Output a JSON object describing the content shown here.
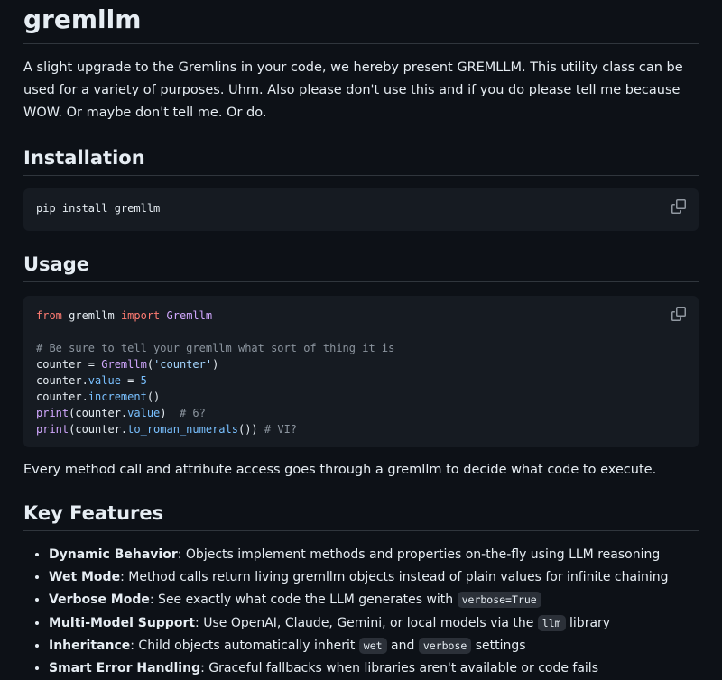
{
  "title": "gremllm",
  "intro": "A slight upgrade to the Gremlins in your code, we hereby present GREMLLM. This utility class can be used for a variety of purposes. Uhm. Also please don't use this and if you do please tell me because WOW. Or maybe don't tell me. Or do.",
  "installation": {
    "heading": "Installation",
    "command": "pip install gremllm"
  },
  "usage": {
    "heading": "Usage",
    "code": {
      "l1": {
        "kw1": "from",
        "mod": " gremllm ",
        "kw2": "import",
        "cls": " Gremllm"
      },
      "l3": "# Be sure to tell your gremllm what sort of thing it is",
      "l4": {
        "a": "counter = ",
        "cls": "Gremllm",
        "b": "(",
        "str": "'counter'",
        "c": ")"
      },
      "l5": {
        "a": "counter.",
        "attr": "value",
        "b": " = ",
        "num": "5"
      },
      "l6": {
        "a": "counter.",
        "fn": "increment",
        "b": "()"
      },
      "l7": {
        "fn": "print",
        "a": "(counter.",
        "attr": "value",
        "b": ")  ",
        "cm": "# 6?"
      },
      "l8": {
        "fn": "print",
        "a": "(counter.",
        "fn2": "to_roman_numerals",
        "b": "()) ",
        "cm": "# VI?"
      }
    },
    "description": "Every method call and attribute access goes through a gremllm to decide what code to execute."
  },
  "features": {
    "heading": "Key Features",
    "items": [
      {
        "name": "Dynamic Behavior",
        "text": ": Objects implement methods and properties on-the-fly using LLM reasoning"
      },
      {
        "name": "Wet Mode",
        "text": ": Method calls return living gremllm objects instead of plain values for infinite chaining"
      },
      {
        "name": "Verbose Mode",
        "text": ": See exactly what code the LLM generates with ",
        "code": "verbose=True"
      },
      {
        "name": "Multi-Model Support",
        "text": ": Use OpenAI, Claude, Gemini, or local models via the ",
        "code": "llm",
        "after": " library"
      },
      {
        "name": "Inheritance",
        "text": ": Child objects automatically inherit ",
        "code": "wet",
        "mid": " and ",
        "code2": "verbose",
        "after": " settings"
      },
      {
        "name": "Smart Error Handling",
        "text": ": Graceful fallbacks when libraries aren't available or code fails"
      }
    ]
  },
  "icons": {
    "copy": "copy-icon"
  }
}
